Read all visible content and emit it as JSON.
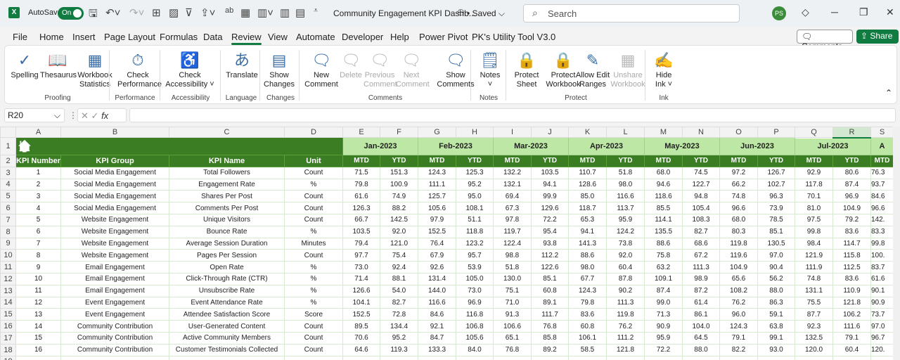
{
  "titlebar": {
    "autosave_label": "AutoSave",
    "autosave_state": "On",
    "doc_title": "Community Engagement KPI Dashb...",
    "saved": "• Saved ⌵",
    "search_placeholder": "Search",
    "avatar": "PS"
  },
  "tabs": [
    "File",
    "Home",
    "Insert",
    "Page Layout",
    "Formulas",
    "Data",
    "Review",
    "View",
    "Automate",
    "Developer",
    "Help",
    "Power Pivot",
    "PK's Utility Tool V3.0"
  ],
  "active_tab": "Review",
  "comments_btn": "Comments",
  "share_btn": "Share",
  "ribbon": {
    "buttons": [
      {
        "label": "Spelling",
        "icon": "spelling-icon",
        "glyph": "✓"
      },
      {
        "label": "Thesaurus",
        "icon": "thesaurus-icon",
        "glyph": "📖"
      },
      {
        "label": "Workbook Statistics",
        "icon": "statistics-icon",
        "glyph": "▦"
      },
      {
        "label": "Check Performance",
        "icon": "performance-icon",
        "glyph": "⏱"
      },
      {
        "label": "Check Accessibility ˅",
        "icon": "accessibility-icon",
        "glyph": "♿"
      },
      {
        "label": "Translate",
        "icon": "translate-icon",
        "glyph": "あ"
      },
      {
        "label": "Show Changes",
        "icon": "changes-icon",
        "glyph": "▤"
      },
      {
        "label": "New Comment",
        "icon": "new-comment-icon",
        "glyph": "🗨"
      },
      {
        "label": "Delete",
        "icon": "delete-comment-icon",
        "glyph": "🗨",
        "disabled": true
      },
      {
        "label": "Previous Comment",
        "icon": "previous-comment-icon",
        "glyph": "🗨",
        "disabled": true
      },
      {
        "label": "Next Comment",
        "icon": "next-comment-icon",
        "glyph": "🗨",
        "disabled": true
      },
      {
        "label": "Show Comments",
        "icon": "show-comments-icon",
        "glyph": "🗨"
      },
      {
        "label": "Notes ˅",
        "icon": "notes-icon",
        "glyph": "🗒"
      },
      {
        "label": "Protect Sheet",
        "icon": "protect-sheet-icon",
        "glyph": "🔒"
      },
      {
        "label": "Protect Workbook",
        "icon": "protect-workbook-icon",
        "glyph": "🔒"
      },
      {
        "label": "Allow Edit Ranges",
        "icon": "edit-ranges-icon",
        "glyph": "✎"
      },
      {
        "label": "Unshare Workbook",
        "icon": "unshare-icon",
        "glyph": "▦",
        "disabled": true
      },
      {
        "label": "Hide Ink ˅",
        "icon": "ink-icon",
        "glyph": "✍"
      }
    ],
    "groups": [
      "Proofing",
      "Performance",
      "Accessibility",
      "Language",
      "Changes",
      "Comments",
      "Notes",
      "Protect",
      "Ink"
    ]
  },
  "formula_bar": {
    "name_box": "R20",
    "fx": "fx",
    "formula": ""
  },
  "columns": [
    "A",
    "B",
    "C",
    "D",
    "E",
    "F",
    "G",
    "H",
    "I",
    "J",
    "K",
    "L",
    "M",
    "N",
    "O",
    "P",
    "Q",
    "R",
    "S"
  ],
  "header": {
    "kpi_number": "KPI Number",
    "kpi_group": "KPI Group",
    "kpi_name": "KPI Name",
    "unit": "Unit",
    "mtd": "MTD",
    "ytd": "YTD"
  },
  "months": [
    "Jan-2023",
    "Feb-2023",
    "Mar-2023",
    "Apr-2023",
    "May-2023",
    "Jun-2023",
    "Jul-2023",
    "A"
  ],
  "rows": [
    {
      "n": "1",
      "g": "Social Media Engagement",
      "k": "Total Followers",
      "u": "Count",
      "v": [
        "71.5",
        "151.3",
        "124.3",
        "125.3",
        "132.2",
        "103.5",
        "110.7",
        "51.8",
        "68.0",
        "74.5",
        "97.2",
        "126.7",
        "92.9",
        "80.6",
        "76.3"
      ]
    },
    {
      "n": "2",
      "g": "Social Media Engagement",
      "k": "Engagement Rate",
      "u": "%",
      "v": [
        "79.8",
        "100.9",
        "111.1",
        "95.2",
        "132.1",
        "94.1",
        "128.6",
        "98.0",
        "94.6",
        "122.7",
        "66.2",
        "102.7",
        "117.8",
        "87.4",
        "93.7"
      ]
    },
    {
      "n": "3",
      "g": "Social Media Engagement",
      "k": "Shares Per Post",
      "u": "Count",
      "v": [
        "61.6",
        "74.9",
        "125.7",
        "95.0",
        "69.4",
        "99.9",
        "85.0",
        "116.6",
        "118.6",
        "94.8",
        "74.8",
        "96.3",
        "70.1",
        "96.9",
        "84.6"
      ]
    },
    {
      "n": "4",
      "g": "Social Media Engagement",
      "k": "Comments Per Post",
      "u": "Count",
      "v": [
        "126.3",
        "88.2",
        "105.6",
        "108.1",
        "67.3",
        "129.6",
        "118.7",
        "113.7",
        "85.5",
        "105.4",
        "96.6",
        "73.9",
        "81.0",
        "104.9",
        "96.6"
      ]
    },
    {
      "n": "5",
      "g": "Website Engagement",
      "k": "Unique Visitors",
      "u": "Count",
      "v": [
        "66.7",
        "142.5",
        "97.9",
        "51.1",
        "97.8",
        "72.2",
        "65.3",
        "95.9",
        "114.1",
        "108.3",
        "68.0",
        "78.5",
        "97.5",
        "79.2",
        "142."
      ]
    },
    {
      "n": "6",
      "g": "Website Engagement",
      "k": "Bounce Rate",
      "u": "%",
      "v": [
        "103.5",
        "92.0",
        "152.5",
        "118.8",
        "119.7",
        "95.4",
        "94.1",
        "124.2",
        "135.5",
        "82.7",
        "80.3",
        "85.1",
        "99.8",
        "83.6",
        "83.3"
      ]
    },
    {
      "n": "7",
      "g": "Website Engagement",
      "k": "Average Session Duration",
      "u": "Minutes",
      "v": [
        "79.4",
        "121.0",
        "76.4",
        "123.2",
        "122.4",
        "93.8",
        "141.3",
        "73.8",
        "88.6",
        "68.6",
        "119.8",
        "130.5",
        "98.4",
        "114.7",
        "99.8"
      ]
    },
    {
      "n": "8",
      "g": "Website Engagement",
      "k": "Pages Per Session",
      "u": "Count",
      "v": [
        "97.7",
        "75.4",
        "67.9",
        "95.7",
        "98.8",
        "112.2",
        "88.6",
        "92.0",
        "75.8",
        "67.2",
        "119.6",
        "97.0",
        "121.9",
        "115.8",
        "100."
      ]
    },
    {
      "n": "9",
      "g": "Email Engagement",
      "k": "Open Rate",
      "u": "%",
      "v": [
        "73.0",
        "92.4",
        "92.6",
        "53.9",
        "51.8",
        "122.6",
        "98.0",
        "60.4",
        "63.2",
        "111.3",
        "104.9",
        "90.4",
        "111.9",
        "112.5",
        "83.7"
      ]
    },
    {
      "n": "10",
      "g": "Email Engagement",
      "k": "Click-Through Rate (CTR)",
      "u": "%",
      "v": [
        "71.4",
        "88.1",
        "131.4",
        "105.0",
        "130.0",
        "85.1",
        "67.7",
        "87.8",
        "109.1",
        "98.9",
        "65.6",
        "56.2",
        "74.8",
        "83.6",
        "61.6"
      ]
    },
    {
      "n": "11",
      "g": "Email Engagement",
      "k": "Unsubscribe Rate",
      "u": "%",
      "v": [
        "126.6",
        "54.0",
        "144.0",
        "73.0",
        "75.1",
        "60.8",
        "124.3",
        "90.2",
        "87.4",
        "87.2",
        "108.2",
        "88.0",
        "131.1",
        "110.9",
        "90.1"
      ]
    },
    {
      "n": "12",
      "g": "Event Engagement",
      "k": "Event Attendance Rate",
      "u": "%",
      "v": [
        "104.1",
        "82.7",
        "116.6",
        "96.9",
        "71.0",
        "89.1",
        "79.8",
        "111.3",
        "99.0",
        "61.4",
        "76.2",
        "86.3",
        "75.5",
        "121.8",
        "90.9"
      ]
    },
    {
      "n": "13",
      "g": "Event Engagement",
      "k": "Attendee Satisfaction Score",
      "u": "Score",
      "v": [
        "152.5",
        "72.8",
        "84.6",
        "116.8",
        "91.3",
        "111.7",
        "83.6",
        "119.8",
        "71.3",
        "86.1",
        "96.0",
        "59.1",
        "87.7",
        "106.2",
        "73.7"
      ]
    },
    {
      "n": "14",
      "g": "Community Contribution",
      "k": "User-Generated Content",
      "u": "Count",
      "v": [
        "89.5",
        "134.4",
        "92.1",
        "106.8",
        "106.6",
        "76.8",
        "60.8",
        "76.2",
        "90.9",
        "104.0",
        "124.3",
        "63.8",
        "92.3",
        "111.6",
        "97.0"
      ]
    },
    {
      "n": "15",
      "g": "Community Contribution",
      "k": "Active Community Members",
      "u": "Count",
      "v": [
        "70.6",
        "95.2",
        "84.7",
        "105.6",
        "65.1",
        "85.8",
        "106.1",
        "111.2",
        "95.9",
        "64.5",
        "79.1",
        "99.1",
        "132.5",
        "79.1",
        "96.7"
      ]
    },
    {
      "n": "16",
      "g": "Community Contribution",
      "k": "Customer Testimonials Collected",
      "u": "Count",
      "v": [
        "64.6",
        "119.3",
        "133.3",
        "84.0",
        "76.8",
        "89.2",
        "58.5",
        "121.8",
        "72.2",
        "88.0",
        "82.2",
        "93.0",
        "120.0",
        "60.4",
        "120."
      ]
    }
  ],
  "colors": {
    "dark_green": "#3a7d23",
    "light_green": "#bde7a4",
    "brand": "#107c41"
  }
}
